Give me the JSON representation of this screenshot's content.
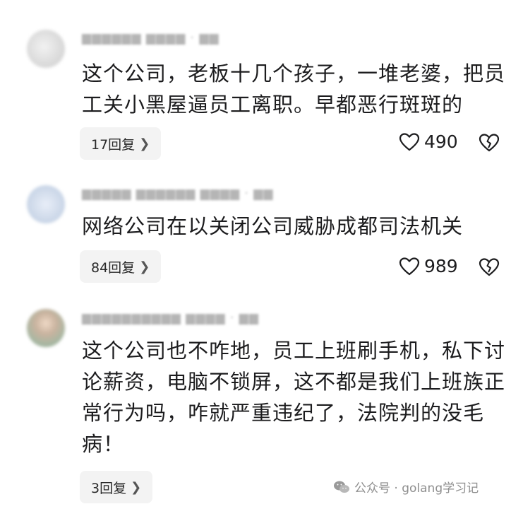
{
  "comments": [
    {
      "content": "这个公司，老板十几个孩子，一堆老婆，把员工关小黑屋逼员工离职。早都恶行斑斑的",
      "reply_label": "17回复",
      "likes": "490"
    },
    {
      "content": "网络公司在以关闭公司威胁成都司法机关",
      "reply_label": "84回复",
      "likes": "989"
    },
    {
      "content": "这个公司也不咋地，员工上班刷手机，私下讨论薪资，电脑不锁屏，这不都是我们上班族正常行为吗，咋就严重违纪了，法院判的没毛病！",
      "reply_label": "3回复"
    }
  ],
  "footer": {
    "label": "公众号 · golang学习记"
  },
  "icons": {
    "like": "heart-outline-icon",
    "dislike": "broken-heart-icon",
    "chevron": "chevron-right-icon",
    "wechat": "wechat-icon"
  }
}
